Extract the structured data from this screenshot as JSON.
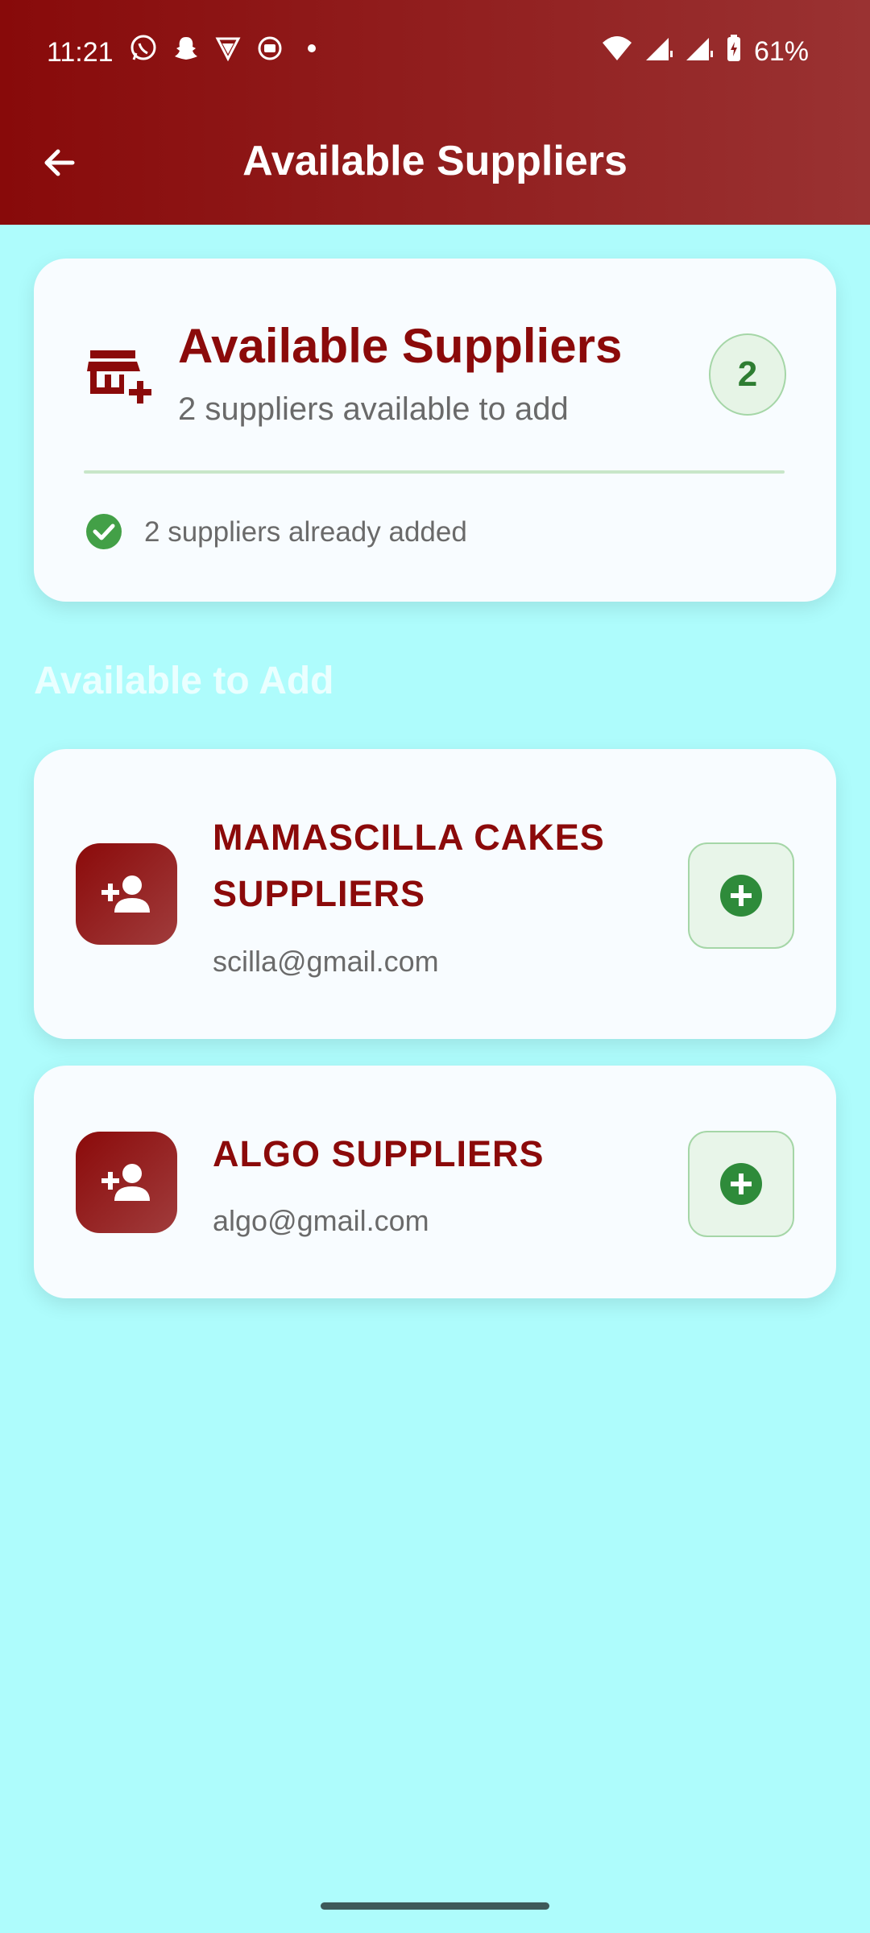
{
  "status_bar": {
    "time": "11:21",
    "battery": "61%",
    "left_icons": [
      "whatsapp-icon",
      "snapchat-icon",
      "vpn-icon",
      "cast-icon",
      "dot-icon"
    ],
    "right_icons": [
      "wifi-icon",
      "signal-icon",
      "signal-icon",
      "battery-icon"
    ]
  },
  "app_bar": {
    "title": "Available Suppliers",
    "back_icon": "arrow-back-icon"
  },
  "summary": {
    "title": "Available Suppliers",
    "subtitle": "2 suppliers available to add",
    "count": "2",
    "added_text": "2 suppliers already added",
    "icon": "store-add-icon"
  },
  "section": {
    "title": "Available to Add"
  },
  "suppliers": [
    {
      "name": "MAMASCILLA CAKES SUPPLIERS",
      "email": "scilla@gmail.com"
    },
    {
      "name": "ALGO SUPPLIERS",
      "email": "algo@gmail.com"
    }
  ],
  "colors": {
    "primary": "#8B0A0A",
    "background": "#AEFCFC",
    "success": "#2E7D32",
    "card": "#F8FCFF"
  }
}
